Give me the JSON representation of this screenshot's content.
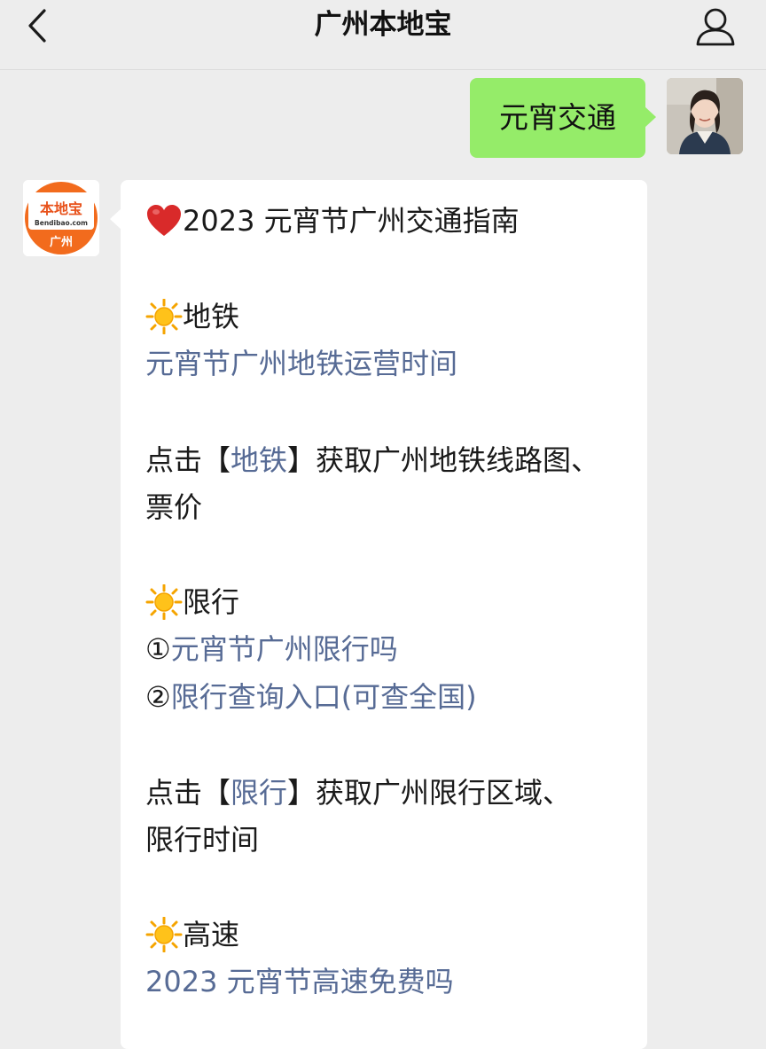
{
  "nav": {
    "title": "广州本地宝",
    "back_icon": "chevron-left-icon",
    "profile_icon": "person-icon"
  },
  "outgoing": {
    "text": "元宵交通"
  },
  "bot_avatar": {
    "brand": "本地宝",
    "domain": "Bendibao.com",
    "city": "广州",
    "color": "#f26b1d"
  },
  "message": {
    "title": "2023 元宵节广州交通指南",
    "subway": {
      "heading": "地铁",
      "link": "元宵节广州地铁运营时间",
      "tip_prefix": "点击【",
      "tip_link": "地铁",
      "tip_suffix": "】获取广州地铁线路图、",
      "tip_line2": "票价"
    },
    "restriction": {
      "heading": "限行",
      "item1_num": "①",
      "item1_link": "元宵节广州限行吗",
      "item2_num": "②",
      "item2_link": "限行查询入口(可查全国)",
      "tip_prefix": "点击【",
      "tip_link": "限行",
      "tip_suffix": "】获取广州限行区域、",
      "tip_line2": "限行时间"
    },
    "highway": {
      "heading": "高速",
      "link": "2023 元宵节高速免费吗"
    }
  },
  "colors": {
    "link": "#576b95",
    "bubble_out": "#95ec69",
    "background": "#ededed"
  }
}
